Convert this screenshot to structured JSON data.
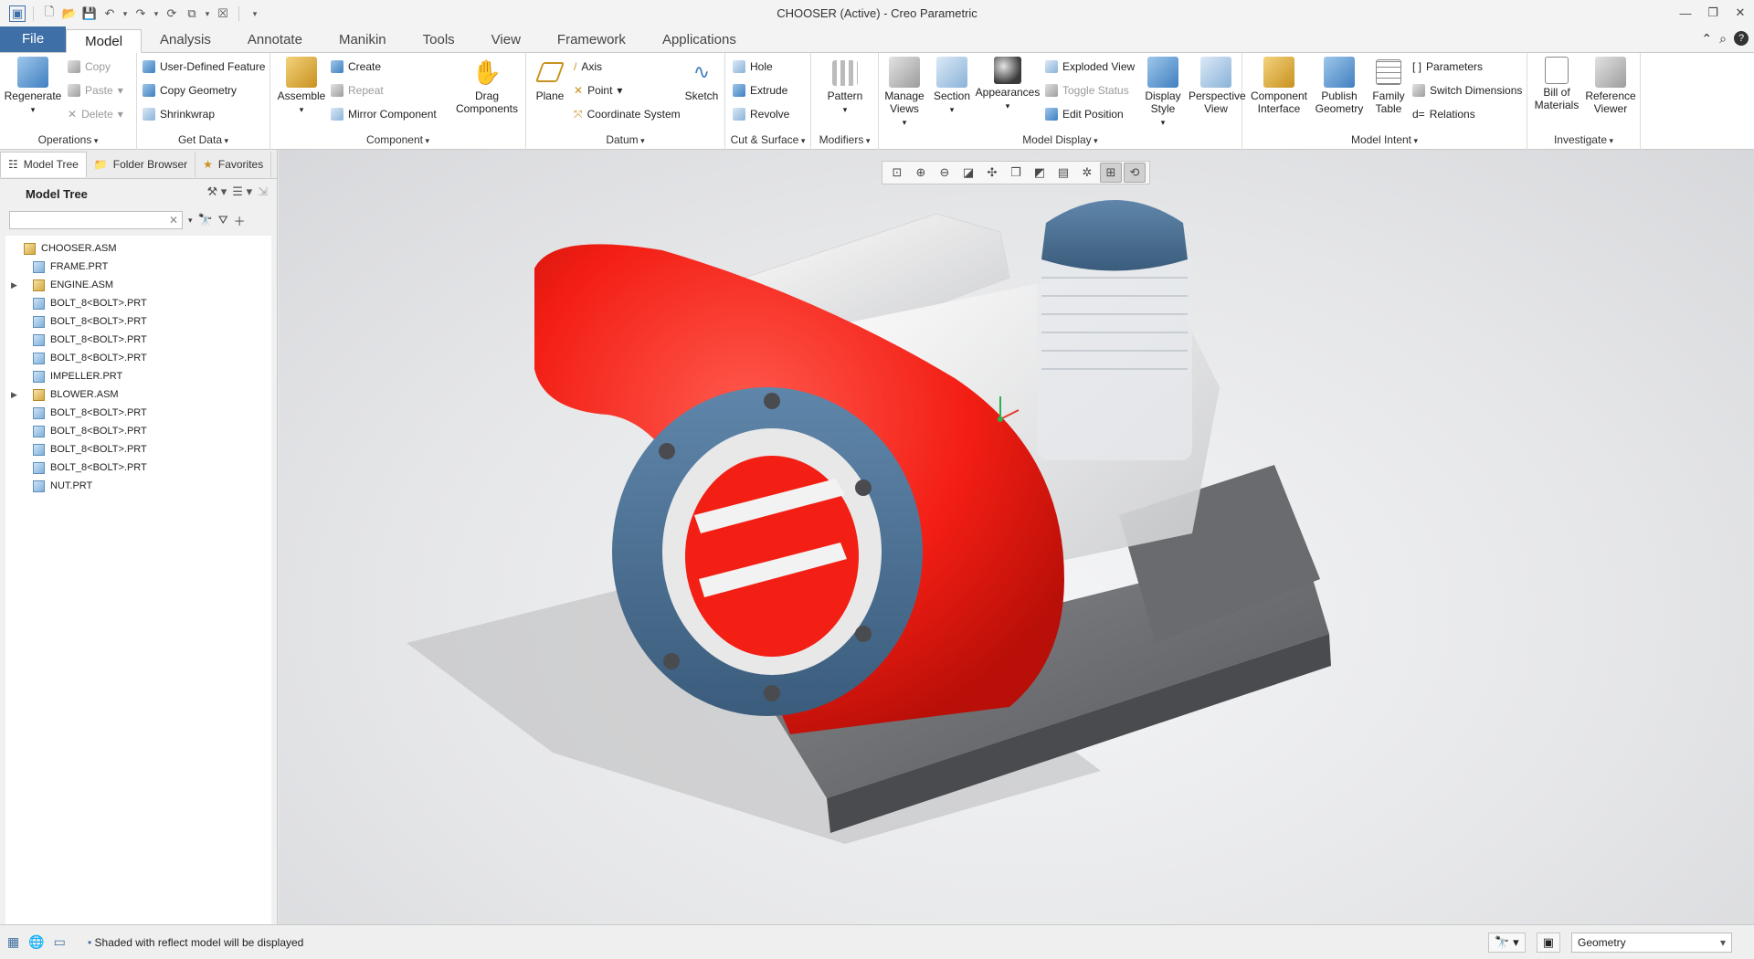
{
  "window": {
    "title": "CHOOSER (Active) - Creo Parametric"
  },
  "quick_access": [
    "new-icon",
    "open-icon",
    "save-icon",
    "undo-icon",
    "redo-icon",
    "regenerate-icon",
    "windows-icon",
    "close-icon",
    "customize-icon"
  ],
  "tabs": [
    {
      "label": "File"
    },
    {
      "label": "Model",
      "active": true
    },
    {
      "label": "Analysis"
    },
    {
      "label": "Annotate"
    },
    {
      "label": "Manikin"
    },
    {
      "label": "Tools"
    },
    {
      "label": "View"
    },
    {
      "label": "Framework"
    },
    {
      "label": "Applications"
    }
  ],
  "ribbon": {
    "operations": {
      "label": "Operations",
      "regenerate": "Regenerate",
      "copy": "Copy",
      "paste": "Paste",
      "delete": "Delete"
    },
    "get_data": {
      "label": "Get Data",
      "udf": "User-Defined Feature",
      "copy_geometry": "Copy Geometry",
      "shrinkwrap": "Shrinkwrap"
    },
    "component": {
      "label": "Component",
      "assemble": "Assemble",
      "create": "Create",
      "repeat": "Repeat",
      "mirror": "Mirror Component",
      "drag": "Drag Components"
    },
    "datum": {
      "label": "Datum",
      "plane": "Plane",
      "axis": "Axis",
      "point": "Point",
      "csys": "Coordinate System",
      "sketch": "Sketch"
    },
    "cut_surface": {
      "label": "Cut & Surface",
      "hole": "Hole",
      "extrude": "Extrude",
      "revolve": "Revolve"
    },
    "modifiers": {
      "label": "Modifiers",
      "pattern": "Pattern"
    },
    "model_display": {
      "label": "Model Display",
      "manage_views": "Manage Views",
      "section": "Section",
      "appearances": "Appearances",
      "exploded": "Exploded View",
      "toggle_status": "Toggle Status",
      "edit_position": "Edit Position",
      "display_style": "Display Style",
      "perspective": "Perspective View"
    },
    "model_intent": {
      "label": "Model Intent",
      "component_interface": "Component Interface",
      "publish_geometry": "Publish Geometry",
      "family_table": "Family Table",
      "parameters": "Parameters",
      "switch_dimensions": "Switch Dimensions",
      "relations": "Relations"
    },
    "investigate": {
      "label": "Investigate",
      "bom": "Bill of Materials",
      "reference_viewer": "Reference Viewer"
    }
  },
  "panel": {
    "tabs": [
      "Model Tree",
      "Folder Browser",
      "Favorites"
    ],
    "tree_title": "Model Tree",
    "search_value": "",
    "items": [
      {
        "label": "CHOOSER.ASM",
        "type": "asm",
        "level": 0,
        "expand": ""
      },
      {
        "label": "FRAME.PRT",
        "type": "prt",
        "level": 1,
        "expand": ""
      },
      {
        "label": "ENGINE.ASM",
        "type": "asm",
        "level": 1,
        "expand": "▶"
      },
      {
        "label": "BOLT_8<BOLT>.PRT",
        "type": "prt",
        "level": 1,
        "expand": ""
      },
      {
        "label": "BOLT_8<BOLT>.PRT",
        "type": "prt",
        "level": 1,
        "expand": ""
      },
      {
        "label": "BOLT_8<BOLT>.PRT",
        "type": "prt",
        "level": 1,
        "expand": ""
      },
      {
        "label": "BOLT_8<BOLT>.PRT",
        "type": "prt",
        "level": 1,
        "expand": ""
      },
      {
        "label": "IMPELLER.PRT",
        "type": "prt",
        "level": 1,
        "expand": ""
      },
      {
        "label": "BLOWER.ASM",
        "type": "asm",
        "level": 1,
        "expand": "▶"
      },
      {
        "label": "BOLT_8<BOLT>.PRT",
        "type": "prt",
        "level": 1,
        "expand": ""
      },
      {
        "label": "BOLT_8<BOLT>.PRT",
        "type": "prt",
        "level": 1,
        "expand": ""
      },
      {
        "label": "BOLT_8<BOLT>.PRT",
        "type": "prt",
        "level": 1,
        "expand": ""
      },
      {
        "label": "BOLT_8<BOLT>.PRT",
        "type": "prt",
        "level": 1,
        "expand": ""
      },
      {
        "label": "NUT.PRT",
        "type": "prt",
        "level": 1,
        "expand": ""
      }
    ]
  },
  "view_toolbar": [
    "refit-icon",
    "zoom-in-icon",
    "zoom-out-icon",
    "repaint-icon",
    "spin-center-icon",
    "named-views-icon",
    "display-style-icon",
    "view-manager-icon",
    "datum-display-icon",
    "annotation-display-icon",
    "spin-icon"
  ],
  "status": {
    "message": "Shaded with reflect model will be displayed",
    "filter": "Geometry"
  },
  "colors": {
    "file_tab": "#3e6fa6",
    "blower": "#ff2a20",
    "flange": "#4e6e8c",
    "base": "#6e6f72"
  }
}
